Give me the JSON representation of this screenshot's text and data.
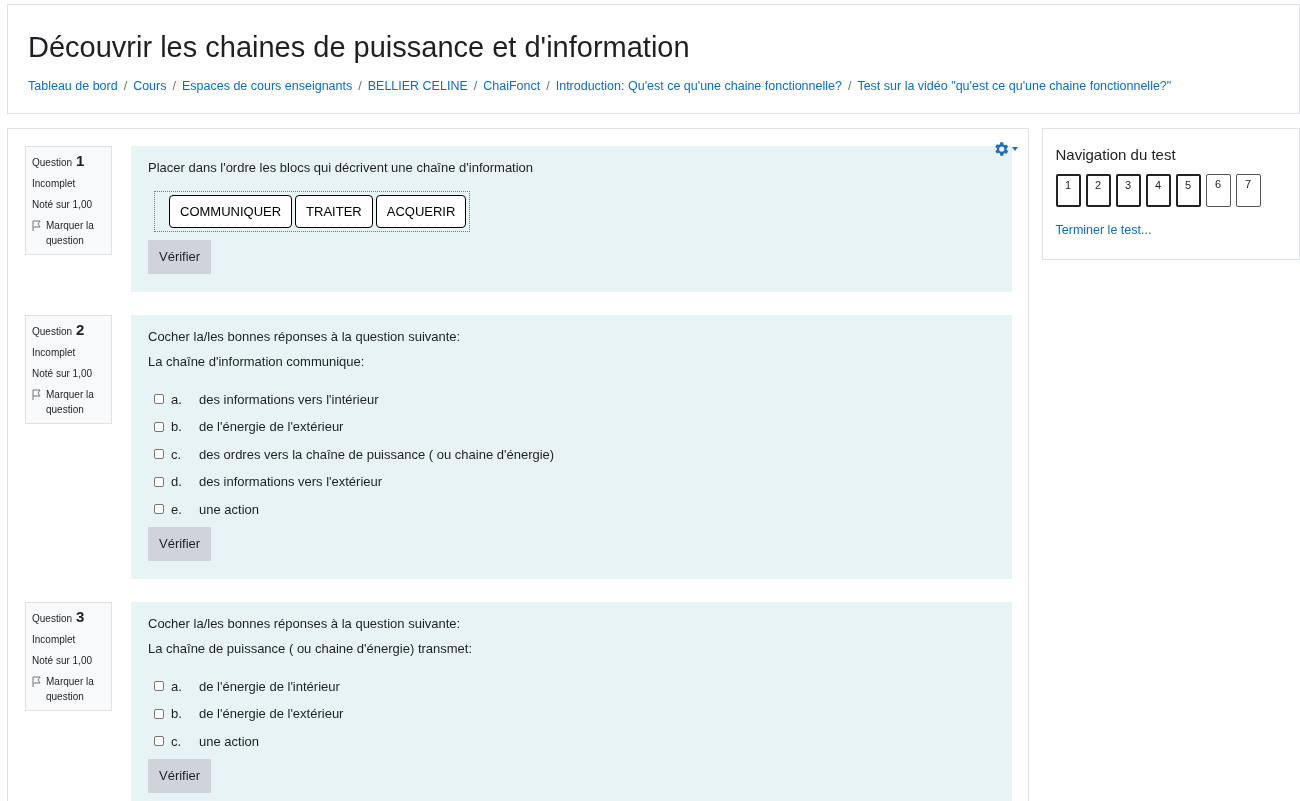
{
  "header": {
    "title": "Découvrir les chaines de puissance et d'information",
    "separator": "/",
    "breadcrumbs": [
      "Tableau de bord",
      "Cours",
      "Espaces de cours enseignants",
      "BELLIER CELINE",
      "ChaiFonct",
      "Introduction: Qu'est ce qu'une chaine fonctionnelle?",
      "Test sur la vidéo \"qu'est ce qu'une chaine fonctionnelle?\""
    ]
  },
  "questions": [
    {
      "label": "Question",
      "number": "1",
      "status": "Incomplet",
      "grade": "Noté sur 1,00",
      "flag": "Marquer la question",
      "kind": "ordering",
      "has_settings": true,
      "prompt": [
        "Placer dans l'ordre les blocs qui décrivent une chaîne d'information"
      ],
      "blocks": [
        "COMMUNIQUER",
        "TRAITER",
        "ACQUERIR"
      ],
      "check_button": "Vérifier"
    },
    {
      "label": "Question",
      "number": "2",
      "status": "Incomplet",
      "grade": "Noté sur 1,00",
      "flag": "Marquer la question",
      "kind": "multichoice",
      "has_settings": false,
      "prompt": [
        "Cocher la/les bonnes réponses à la question suivante:",
        "La chaîne d'information communique:"
      ],
      "options": [
        {
          "letter": "a.",
          "text": "des informations vers l'intérieur",
          "checked": false
        },
        {
          "letter": "b.",
          "text": "de l'énergie de l'extérieur",
          "checked": false
        },
        {
          "letter": "c.",
          "text": "des ordres vers la chaîne de puissance ( ou chaine d'énergie)",
          "checked": false
        },
        {
          "letter": "d.",
          "text": "des informations vers l'extérieur",
          "checked": false
        },
        {
          "letter": "e.",
          "text": "une action",
          "checked": false
        }
      ],
      "check_button": "Vérifier"
    },
    {
      "label": "Question",
      "number": "3",
      "status": "Incomplet",
      "grade": "Noté sur 1,00",
      "flag": "Marquer la question",
      "kind": "multichoice",
      "has_settings": false,
      "prompt": [
        "Cocher la/les bonnes réponses à la question suivante:",
        "La chaîne de puissance ( ou chaine d'énergie) transmet:"
      ],
      "options": [
        {
          "letter": "a.",
          "text": "de l'énergie de l'intérieur",
          "checked": false
        },
        {
          "letter": "b.",
          "text": "de l'énergie de l'extérieur",
          "checked": false
        },
        {
          "letter": "c.",
          "text": "une action",
          "checked": false
        }
      ],
      "check_button": "Vérifier"
    }
  ],
  "navigation": {
    "title": "Navigation du test",
    "buttons": [
      {
        "label": "1",
        "current": true
      },
      {
        "label": "2",
        "current": true
      },
      {
        "label": "3",
        "current": true
      },
      {
        "label": "4",
        "current": true
      },
      {
        "label": "5",
        "current": true
      },
      {
        "label": "6",
        "current": false
      },
      {
        "label": "7",
        "current": false
      }
    ],
    "finish_link": "Terminer le test..."
  }
}
